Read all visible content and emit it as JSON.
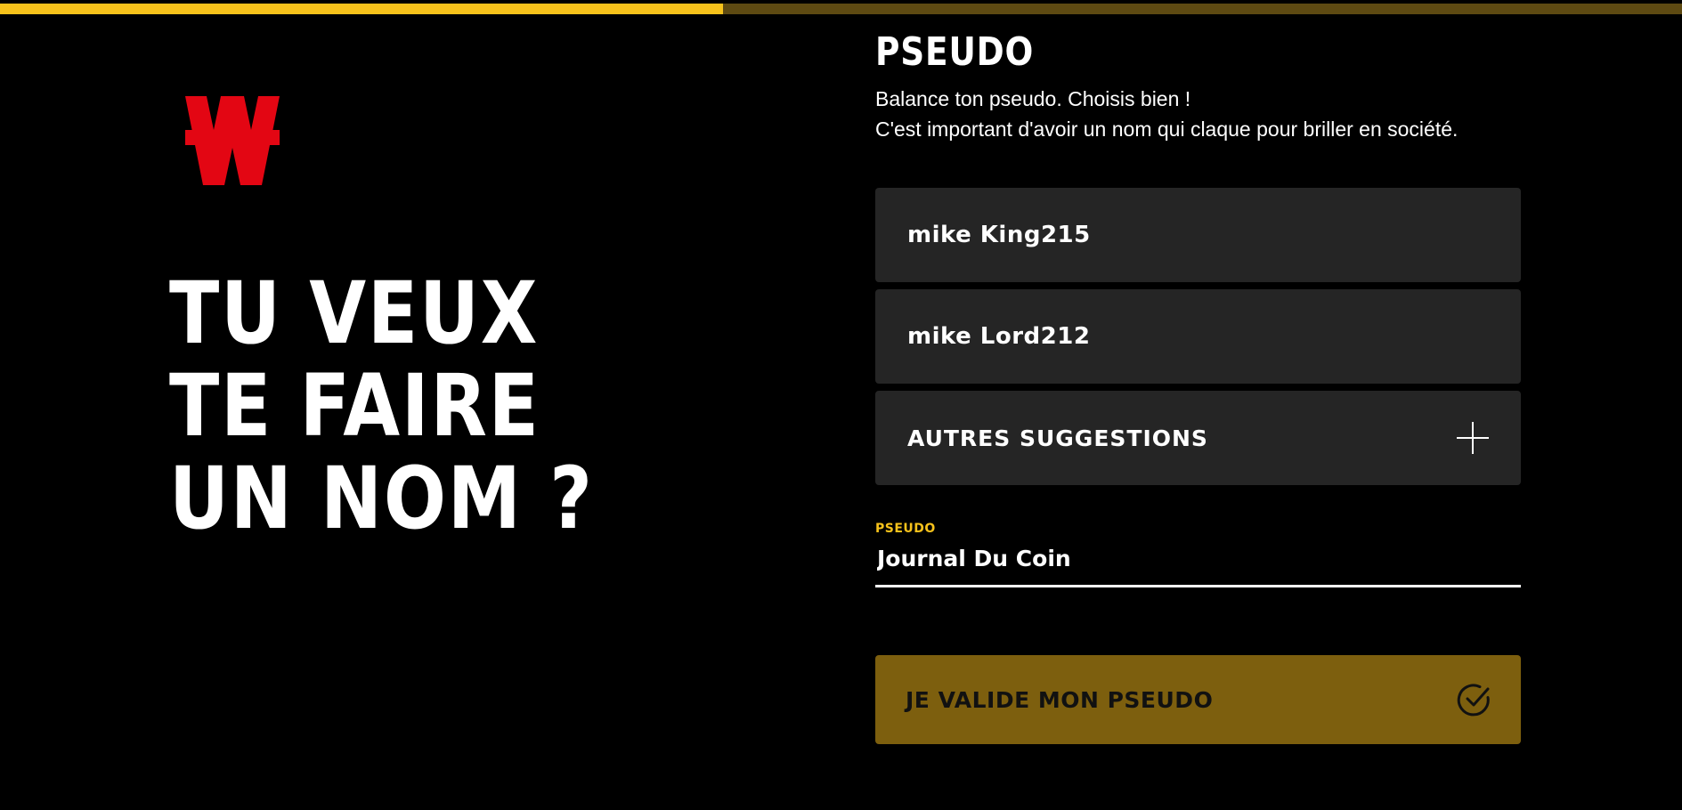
{
  "progress": {
    "value_percent": 43,
    "fill_color": "#f7c21b",
    "track_color": "#5e4a12"
  },
  "logo": {
    "icon": "won-sign-logo-icon",
    "color": "#e30613"
  },
  "hero": {
    "title": "TU VEUX TE FAIRE UN NOM ?"
  },
  "form": {
    "title": "PSEUDO",
    "intro_line_1": "Balance ton pseudo. Choisis bien !",
    "intro_line_2": "C'est important d'avoir un nom qui claque pour briller en société.",
    "suggestions": [
      {
        "label": "mike King215"
      },
      {
        "label": "mike Lord212"
      }
    ],
    "more_suggestions": {
      "label": "AUTRES SUGGESTIONS",
      "icon": "plus-icon"
    },
    "pseudo_field": {
      "label": "PSEUDO",
      "value": "Journal Du Coin"
    },
    "submit": {
      "label": "JE VALIDE MON PSEUDO",
      "icon": "check-circle-icon",
      "color": "#7d5f0e"
    }
  }
}
